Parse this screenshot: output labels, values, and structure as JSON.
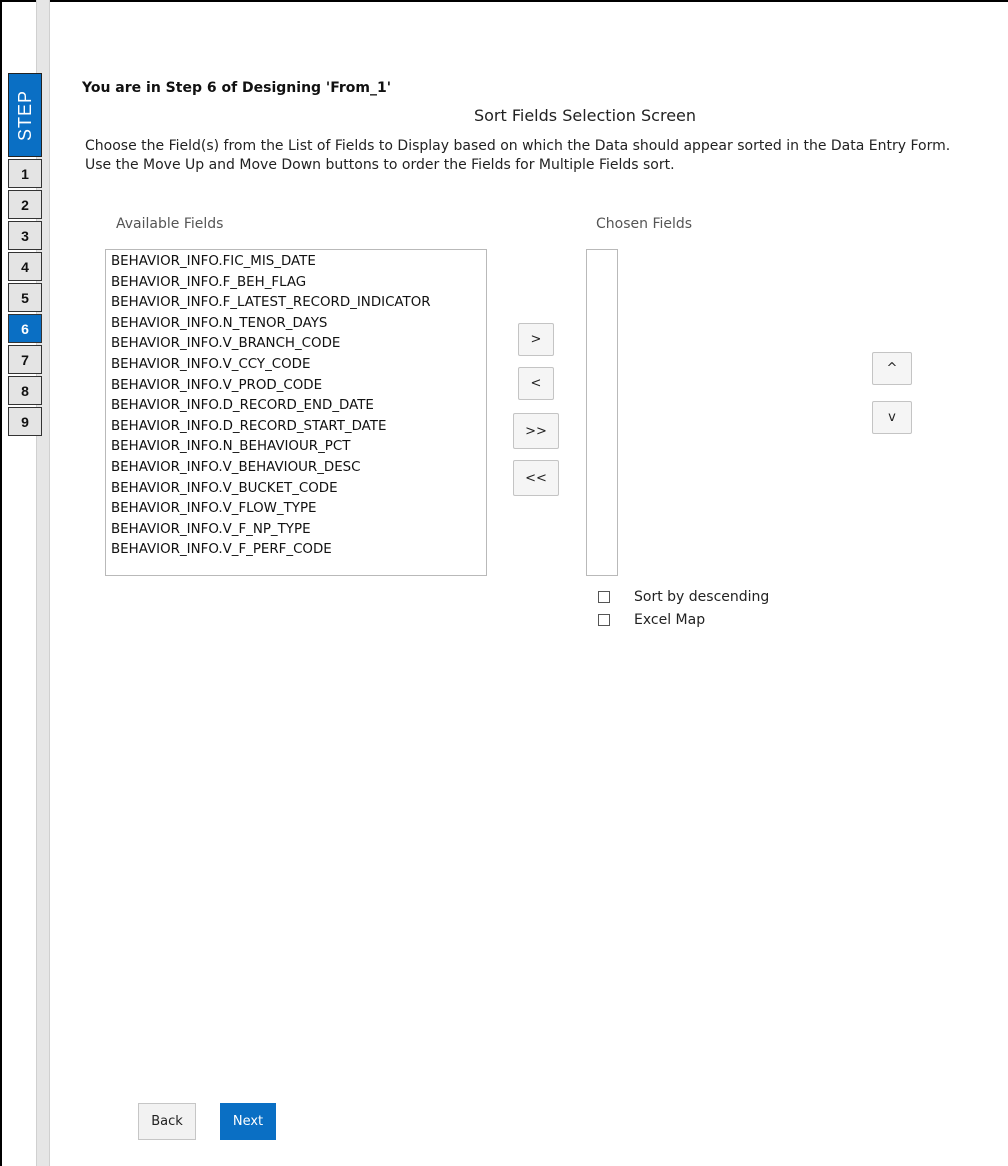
{
  "stepper": {
    "title": "STEP",
    "steps": [
      "1",
      "2",
      "3",
      "4",
      "5",
      "6",
      "7",
      "8",
      "9"
    ],
    "active_step": "6"
  },
  "header": {
    "heading": "You are in Step 6 of Designing 'From_1'",
    "screen_title": "Sort Fields Selection Screen",
    "instruction_1": "Choose the Field(s) from the List of Fields to Display based on which the Data should appear sorted in the Data Entry Form.",
    "instruction_2": "Use the Move Up and Move Down buttons to order the Fields for Multiple Fields sort."
  },
  "available": {
    "label": "Available Fields",
    "items": [
      "BEHAVIOR_INFO.FIC_MIS_DATE",
      "BEHAVIOR_INFO.F_BEH_FLAG",
      "BEHAVIOR_INFO.F_LATEST_RECORD_INDICATOR",
      "BEHAVIOR_INFO.N_TENOR_DAYS",
      "BEHAVIOR_INFO.V_BRANCH_CODE",
      "BEHAVIOR_INFO.V_CCY_CODE",
      "BEHAVIOR_INFO.V_PROD_CODE",
      "BEHAVIOR_INFO.D_RECORD_END_DATE",
      "BEHAVIOR_INFO.D_RECORD_START_DATE",
      "BEHAVIOR_INFO.N_BEHAVIOUR_PCT",
      "BEHAVIOR_INFO.V_BEHAVIOUR_DESC",
      "BEHAVIOR_INFO.V_BUCKET_CODE",
      "BEHAVIOR_INFO.V_FLOW_TYPE",
      "BEHAVIOR_INFO.V_F_NP_TYPE",
      "BEHAVIOR_INFO.V_F_PERF_CODE"
    ]
  },
  "chosen": {
    "label": "Chosen Fields",
    "items": []
  },
  "transfer": {
    "move_right": ">",
    "move_left": "<",
    "move_all_right": ">>",
    "move_all_left": "<<"
  },
  "order": {
    "up": "^",
    "down": "v"
  },
  "options": {
    "sort_desc_label": "Sort by descending",
    "sort_desc_checked": false,
    "excel_map_label": "Excel Map",
    "excel_map_checked": false
  },
  "footer": {
    "back_label": "Back",
    "next_label": "Next"
  }
}
